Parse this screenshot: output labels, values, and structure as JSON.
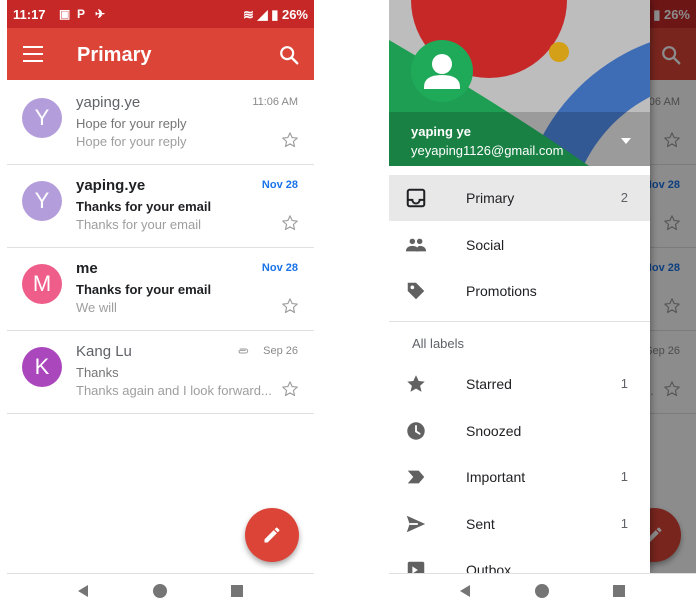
{
  "status_bar": {
    "time": "11:17",
    "battery": "26%"
  },
  "app_bar": {
    "title": "Primary"
  },
  "mails": [
    {
      "sender": "yaping.ye",
      "subject": "Hope for your reply",
      "snippet": "Hope for your reply",
      "date": "11:06 AM",
      "initial": "Y",
      "avatar_color": "#b39ddb",
      "unread": false,
      "attachment": false
    },
    {
      "sender": "yaping.ye",
      "subject": "Thanks for your email",
      "snippet": "Thanks for your email",
      "date": "Nov 28",
      "initial": "Y",
      "avatar_color": "#b39ddb",
      "unread": true,
      "attachment": false
    },
    {
      "sender": "me",
      "subject": "Thanks for your email",
      "snippet": "We will",
      "date": "Nov 28",
      "initial": "M",
      "avatar_color": "#ef5d8a",
      "unread": true,
      "attachment": false
    },
    {
      "sender": "Kang Lu",
      "subject": "Thanks",
      "snippet": "Thanks again and I look forward...",
      "date": "Sep 26",
      "initial": "K",
      "avatar_color": "#ab47bc",
      "unread": false,
      "attachment": true
    }
  ],
  "drawer": {
    "account": {
      "name": "yaping ye",
      "email": "yeyaping1126@gmail.com"
    },
    "items": [
      {
        "label": "Primary",
        "count": "2",
        "icon": "inbox-icon",
        "selected": true
      },
      {
        "label": "Social",
        "count": "",
        "icon": "people-icon",
        "selected": false
      },
      {
        "label": "Promotions",
        "count": "",
        "icon": "tag-icon",
        "selected": false
      }
    ],
    "section_label": "All labels",
    "labels": [
      {
        "label": "Starred",
        "count": "1",
        "icon": "star-icon"
      },
      {
        "label": "Snoozed",
        "count": "",
        "icon": "clock-icon"
      },
      {
        "label": "Important",
        "count": "1",
        "icon": "important-icon"
      },
      {
        "label": "Sent",
        "count": "1",
        "icon": "send-icon"
      },
      {
        "label": "Outbox",
        "count": "",
        "icon": "outbox-icon"
      }
    ]
  },
  "colors": {
    "app_bar": "#db4437",
    "status_bar": "#c62828",
    "unread_date": "#1a73e8",
    "fab": "#db4437"
  }
}
